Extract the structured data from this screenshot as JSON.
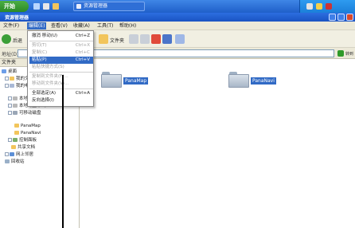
{
  "taskbar": {
    "start_label": "开始",
    "task_title": "资源管理器"
  },
  "window": {
    "title": "资源管理器"
  },
  "menu": [
    "文件(F)",
    "编辑(E)",
    "查看(V)",
    "收藏(A)",
    "工具(T)",
    "帮助(H)"
  ],
  "toolbar": {
    "back": "后退",
    "folders": "文件夹"
  },
  "address": {
    "label": "地址(D)",
    "go": "转到"
  },
  "folder_pane": {
    "header": "文件夹",
    "tree": [
      "桌面",
      "我的文档",
      "我的电脑",
      "本地磁盘",
      "本地磁盘 (D:)",
      "可移动磁盘",
      "PanaMap",
      "PanaNavi",
      "控制面板",
      "共享文档",
      "网上邻居",
      "回收站"
    ]
  },
  "dropdown": {
    "items": [
      {
        "label": "撤消 移动(U)",
        "shortcut": "Ctrl+Z",
        "state": "normal"
      },
      {
        "label": "剪切(T)",
        "shortcut": "Ctrl+X",
        "state": "gray"
      },
      {
        "label": "复制(C)",
        "shortcut": "Ctrl+C",
        "state": "gray"
      },
      {
        "label": "粘贴(P)",
        "shortcut": "Ctrl+V",
        "state": "highlighted"
      },
      {
        "label": "粘贴快捷方式(S)",
        "shortcut": "",
        "state": "gray"
      },
      {
        "label": "复制到文件夹(F)...",
        "shortcut": "",
        "state": "gray"
      },
      {
        "label": "移动到文件夹(V)...",
        "shortcut": "",
        "state": "gray"
      },
      {
        "label": "全部选定(A)",
        "shortcut": "Ctrl+A",
        "state": "normal"
      },
      {
        "label": "反向选择(I)",
        "shortcut": "",
        "state": "normal"
      }
    ]
  },
  "content": {
    "folders": [
      "PanaMap",
      "PanaNavi"
    ]
  },
  "colors": {
    "selection": "#316ac5",
    "taskbar": "#2a6fd9",
    "start": "#3a9c33"
  }
}
